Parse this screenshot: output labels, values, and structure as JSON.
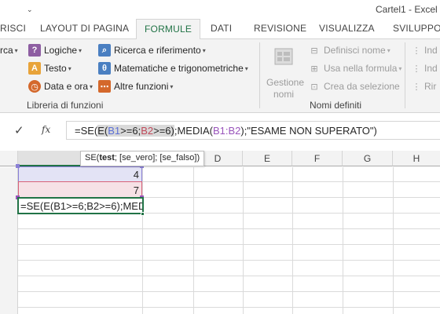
{
  "window": {
    "title": "Cartel1 - Excel",
    "qa_dropdown": "⌄"
  },
  "tabs": [
    {
      "label": "RISCI",
      "active": false
    },
    {
      "label": "LAYOUT DI PAGINA",
      "active": false
    },
    {
      "label": "FORMULE",
      "active": true
    },
    {
      "label": "DATI",
      "active": false
    },
    {
      "label": "REVISIONE",
      "active": false
    },
    {
      "label": "VISUALIZZA",
      "active": false
    },
    {
      "label": "SVILUPPO",
      "active": false
    }
  ],
  "ribbon": {
    "library": {
      "cut_left": "rca",
      "logiche": "Logiche",
      "testo": "Testo",
      "data_ora": "Data e ora",
      "ricerca": "Ricerca e riferimento",
      "matematiche": "Matematiche e trigonometriche",
      "altre": "Altre funzioni",
      "group_label": "Libreria di funzioni",
      "icon_colors": {
        "logiche": "#8e5ea2",
        "testo": "#e8a33a",
        "data": "#d4682b",
        "ricerca": "#4a7fc1",
        "math": "#4a7fc1",
        "altre": "#d4682b"
      }
    },
    "names": {
      "gestione_line1": "Gestione",
      "gestione_line2": "nomi",
      "definisci": "Definisci nome",
      "usa": "Usa nella formula",
      "crea": "Crea da selezione",
      "group_label": "Nomi definiti"
    },
    "audit": {
      "r1": "Ind",
      "r2": "Ind",
      "r3": "Rir"
    }
  },
  "formula_bar": {
    "cancel_icon": "✓",
    "fx": "fx",
    "parts": {
      "p1": "=SE(",
      "p2": "E(",
      "p3": "B1",
      "p4": ">=6;",
      "p5": "B2",
      "p6": ">=6)",
      "p7": ";MEDIA(",
      "p8": "B1:B2",
      "p9": ");\"ESAME NON SUPERATO\")"
    }
  },
  "grid": {
    "columns": [
      "D",
      "E",
      "F",
      "G",
      "H"
    ],
    "cells": {
      "b1": "4",
      "b2": "7",
      "b3_edit": "=SE(E(B1>=6;B2>=6);MEDI"
    },
    "tooltip": {
      "fn": "SE(",
      "arg_bold": "test",
      "rest": "; [se_vero]; [se_falso])"
    },
    "colors": {
      "b1_fill": "#e3e3f5",
      "b1_border": "#8a7fd6",
      "b2_fill": "#f6e1e6",
      "b2_border": "#d86178",
      "active_border": "#217346",
      "accent": "#217346"
    }
  }
}
